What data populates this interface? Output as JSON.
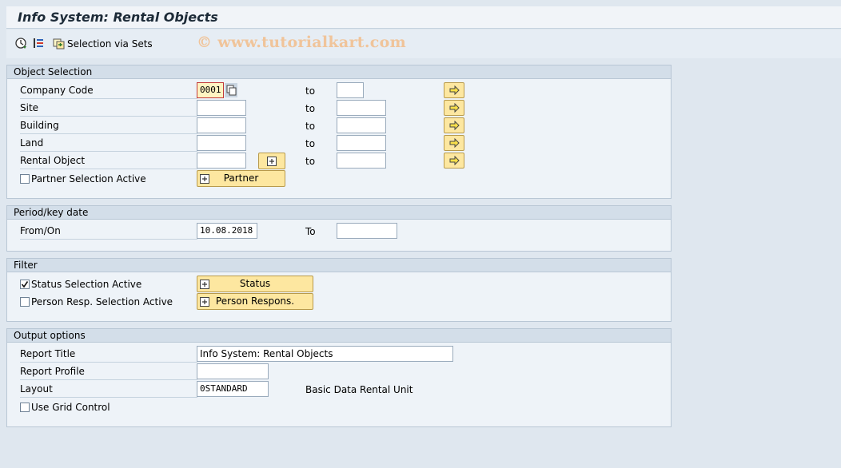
{
  "title": "Info System: Rental Objects",
  "toolbar": {
    "execute_icon": "execute-icon",
    "variant_icon": "variants-icon",
    "selection_sets_label": "Selection via Sets"
  },
  "watermark": "© www.tutorialkart.com",
  "object_selection": {
    "header": "Object Selection",
    "to_label": "to",
    "rows": [
      {
        "label": "Company Code",
        "value": "0001"
      },
      {
        "label": "Site",
        "value": ""
      },
      {
        "label": "Building",
        "value": ""
      },
      {
        "label": "Land",
        "value": ""
      },
      {
        "label": "Rental Object",
        "value": ""
      }
    ],
    "partner_checkbox_label": "Partner Selection Active",
    "partner_button_label": "Partner"
  },
  "period": {
    "header": "Period/key date",
    "from_label": "From/On",
    "from_value": "10.08.2018",
    "to_label": "To",
    "to_value": ""
  },
  "filter": {
    "header": "Filter",
    "status_label": "Status Selection Active",
    "status_checked": true,
    "status_button": "Status",
    "person_label": "Person Resp. Selection Active",
    "person_checked": false,
    "person_button": "Person Respons."
  },
  "output": {
    "header": "Output options",
    "report_title_label": "Report Title",
    "report_title_value": "Info System: Rental Objects",
    "report_profile_label": "Report Profile",
    "report_profile_value": "",
    "layout_label": "Layout",
    "layout_value": "0STANDARD",
    "layout_desc": "Basic Data Rental Unit",
    "grid_label": "Use Grid Control",
    "grid_checked": false
  },
  "colors": {
    "background": "#dfe7ef",
    "group_header": "#d3dee9",
    "button": "#fde7a0"
  }
}
